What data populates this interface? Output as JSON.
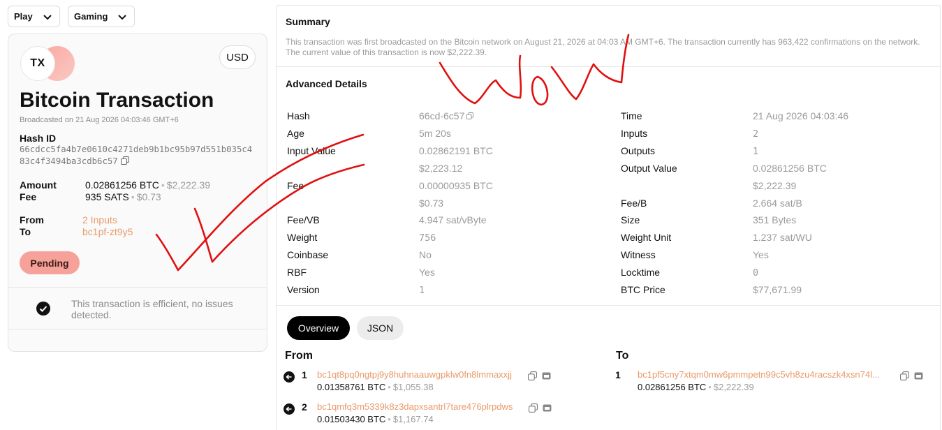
{
  "top": {
    "play_label": "Play",
    "gaming_label": "Gaming"
  },
  "card": {
    "logo_text": "TX",
    "currency": "USD",
    "title": "Bitcoin Transaction",
    "broadcasted": "Broadcasted on 21 Aug 2026 04:03:46 GMT+6",
    "hash_label": "Hash ID",
    "hash_value": "66cdcc5fa4b7e0610c4271deb9b1bc95b97d551b035c483c4f3494ba3cdb6c57",
    "amount_label": "Amount",
    "amount_btc": "0.02861256 BTC",
    "amount_usd": "$2,222.39",
    "fee_label": "Fee",
    "fee_sats": "935 SATS",
    "fee_usd": "$0.73",
    "from_label": "From",
    "from_value": "2 Inputs",
    "to_label": "To",
    "to_value": "bc1pf-zt9y5",
    "status": "Pending",
    "efficiency_text": "This transaction is efficient, no issues detected."
  },
  "summary": {
    "title": "Summary",
    "text": "This transaction was first broadcasted on the Bitcoin network on August 21, 2026 at 04:03 AM GMT+6. The transaction currently has 963,422 confirmations on the network. The current value of this transaction is now $2,222.39."
  },
  "advanced": {
    "title": "Advanced Details",
    "left": [
      {
        "label": "Hash",
        "value": "66cd-6c57"
      },
      {
        "label": "Age",
        "value": "5m 20s"
      },
      {
        "label": "Input Value",
        "value": "0.02862191 BTC"
      },
      {
        "label": "",
        "value": "$2,223.12"
      },
      {
        "label": "Fee",
        "value": "0.00000935 BTC"
      },
      {
        "label": "",
        "value": "$0.73"
      },
      {
        "label": "Fee/VB",
        "value": "4.947 sat/vByte"
      },
      {
        "label": "Weight",
        "value": "756"
      },
      {
        "label": "Coinbase",
        "value": "No"
      },
      {
        "label": "RBF",
        "value": "Yes"
      },
      {
        "label": "Version",
        "value": "1"
      }
    ],
    "right": [
      {
        "label": "Time",
        "value": "21 Aug 2026 04:03:46"
      },
      {
        "label": "Inputs",
        "value": "2"
      },
      {
        "label": "Outputs",
        "value": "1"
      },
      {
        "label": "Output Value",
        "value": "0.02861256 BTC"
      },
      {
        "label": "",
        "value": "$2,222.39"
      },
      {
        "label": "Fee/B",
        "value": "2.664 sat/B"
      },
      {
        "label": "Size",
        "value": "351 Bytes"
      },
      {
        "label": "Weight Unit",
        "value": "1.237 sat/WU"
      },
      {
        "label": "Witness",
        "value": "Yes"
      },
      {
        "label": "Locktime",
        "value": "0"
      },
      {
        "label": "BTC Price",
        "value": "$77,671.99"
      }
    ]
  },
  "tabs": {
    "overview": "Overview",
    "json": "JSON"
  },
  "io": {
    "from_title": "From",
    "to_title": "To",
    "inputs": [
      {
        "index": "1",
        "address": "bc1qt8pq0ngtpj9y8huhnaauwgpklw0fn8lmmaxxjj",
        "btc": "0.01358761 BTC",
        "usd": "$1,055.38"
      },
      {
        "index": "2",
        "address": "bc1qmfq3m5339k8z3dapxsantrl7tare476plrpdws",
        "btc": "0.01503430 BTC",
        "usd": "$1,167.74"
      }
    ],
    "outputs": [
      {
        "index": "1",
        "address": "bc1pf5cny7xtqm0mw6pmmpetn99c5vh8zu4racszk4xsn74l...",
        "btc": "0.02861256 BTC",
        "usd": "$2,222.39"
      }
    ]
  },
  "colors": {
    "accent_orange": "#e89a6a",
    "pending_bg": "#f6a29a",
    "scribble_red": "#e01010"
  }
}
